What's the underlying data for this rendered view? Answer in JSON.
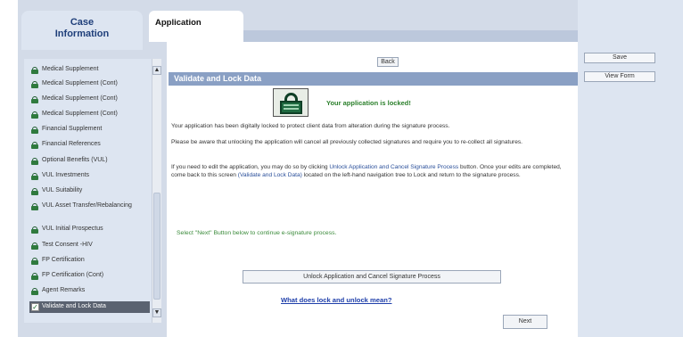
{
  "left_tab": {
    "title_line1": "Case",
    "title_line2": "Information"
  },
  "app_tab": {
    "label": "Application"
  },
  "nav": {
    "items": [
      {
        "label": "Medical Supplement",
        "icon": "lock-icon"
      },
      {
        "label": "Medical Supplement (Cont)",
        "icon": "lock-icon"
      },
      {
        "label": "Medical Supplement (Cont)",
        "icon": "lock-icon"
      },
      {
        "label": "Medical Supplement (Cont)",
        "icon": "lock-icon"
      },
      {
        "label": "Financial Supplement",
        "icon": "lock-icon"
      },
      {
        "label": "Financial References",
        "icon": "lock-icon"
      },
      {
        "label": "Optional Benefits (VUL)",
        "icon": "lock-icon"
      },
      {
        "label": "VUL Investments",
        "icon": "lock-icon"
      },
      {
        "label": "VUL Suitability",
        "icon": "lock-icon"
      },
      {
        "label": "VUL Asset Transfer/Rebalancing",
        "icon": "lock-icon"
      },
      {
        "label": "VUL Initial Prospectus",
        "icon": "lock-icon"
      },
      {
        "label": "Test Consent -HIV",
        "icon": "lock-icon"
      },
      {
        "label": "FP Certification",
        "icon": "lock-icon"
      },
      {
        "label": "FP Certification (Cont)",
        "icon": "lock-icon"
      },
      {
        "label": "Agent Remarks",
        "icon": "lock-icon"
      },
      {
        "label": "Validate and Lock Data",
        "icon": "checkbox-icon"
      }
    ]
  },
  "buttons": {
    "back": "Back",
    "save": "Save",
    "view_form": "View Form",
    "unlock": "Unlock Application and Cancel Signature Process",
    "next": "Next"
  },
  "content": {
    "section_title": "Validate and Lock Data",
    "locked_message": "Your application is locked!",
    "para1": "Your application has been digitally locked to protect client data from alteration during the signature process.",
    "para2": "Please be aware that unlocking the application will cancel all previously collected signatures and require you to re-collect all signatures.",
    "para3_a": "If you need to edit the application, you may do so by clicking ",
    "para3_b": "Unlock Application and Cancel Signature Process",
    "para3_c": " button. Once your edits are completed, come back to this screen ",
    "para3_d": "(Validate and Lock Data)",
    "para3_e": " located on the left-hand navigation tree to Lock and return to the signature process.",
    "next_note": "Select \"Next\" Button below to continue e-signature process.",
    "link": "What does lock and unlock mean?"
  },
  "colors": {
    "section_head": "#8aa0c4",
    "locked_text": "#2a7f2a",
    "link": "#1f3faa"
  }
}
